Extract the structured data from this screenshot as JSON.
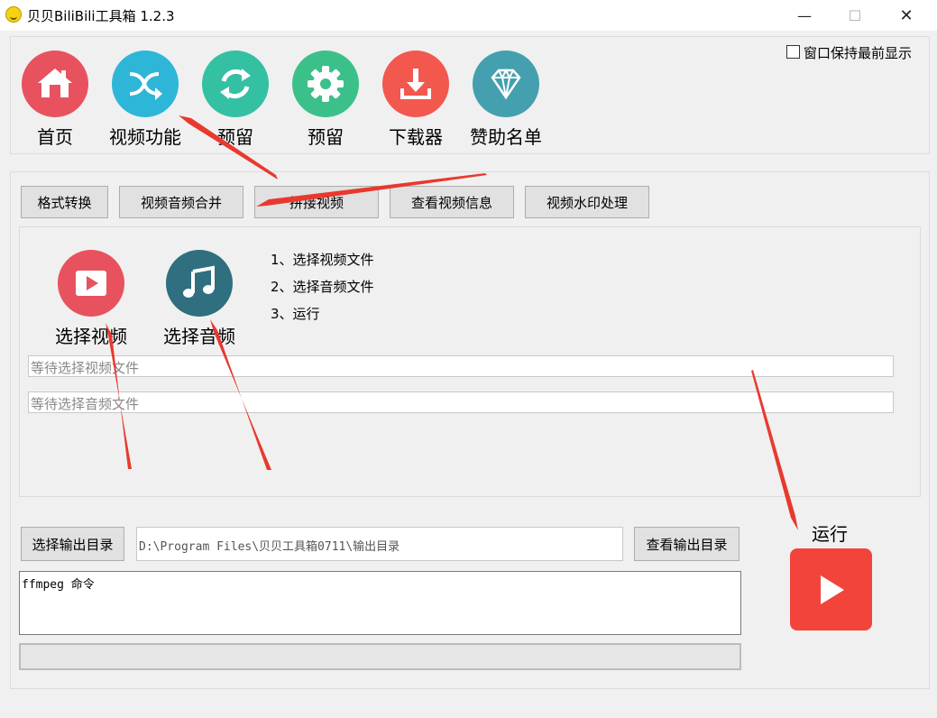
{
  "window": {
    "title": "贝贝BiliBili工具箱 1.2.3",
    "controls": {
      "minimize": "—",
      "maximize": "☐",
      "close": "✕"
    }
  },
  "topmost": {
    "label": "窗口保持最前显示",
    "checked": false
  },
  "nav": [
    {
      "label": "首页",
      "icon": "home-icon",
      "color": "#e8525e"
    },
    {
      "label": "视频功能",
      "icon": "shuffle-arrow-icon",
      "color": "#2eb6d8"
    },
    {
      "label": "预留",
      "icon": "refresh-icon",
      "color": "#34c0a3"
    },
    {
      "label": "预留",
      "icon": "gear-icon",
      "color": "#3cc08a"
    },
    {
      "label": "下载器",
      "icon": "download-icon",
      "color": "#f3584e"
    },
    {
      "label": "赞助名单",
      "icon": "diamond-icon",
      "color": "#44a0ae"
    }
  ],
  "tabs": [
    "格式转换",
    "视频音频合并",
    "拼接视频",
    "查看视频信息",
    "视频水印处理"
  ],
  "merge": {
    "select_video": {
      "label": "选择视频",
      "icon": "video-play-icon",
      "color": "#e8525e"
    },
    "select_audio": {
      "label": "选择音频",
      "icon": "music-note-icon",
      "color": "#2f6f7f"
    },
    "steps": [
      "1、选择视频文件",
      "2、选择音频文件",
      "3、运行"
    ],
    "video_path_placeholder": "等待选择视频文件",
    "audio_path_placeholder": "等待选择音频文件"
  },
  "output": {
    "select_dir_label": "选择输出目录",
    "dir_value": "D:\\Program Files\\贝贝工具箱0711\\输出目录",
    "open_dir_label": "查看输出目录"
  },
  "command": {
    "text": "ffmpeg 命令"
  },
  "progress": {
    "value": 0
  },
  "run": {
    "label": "运行",
    "color": "#f2443b"
  },
  "annotation_color": "#e8392e"
}
